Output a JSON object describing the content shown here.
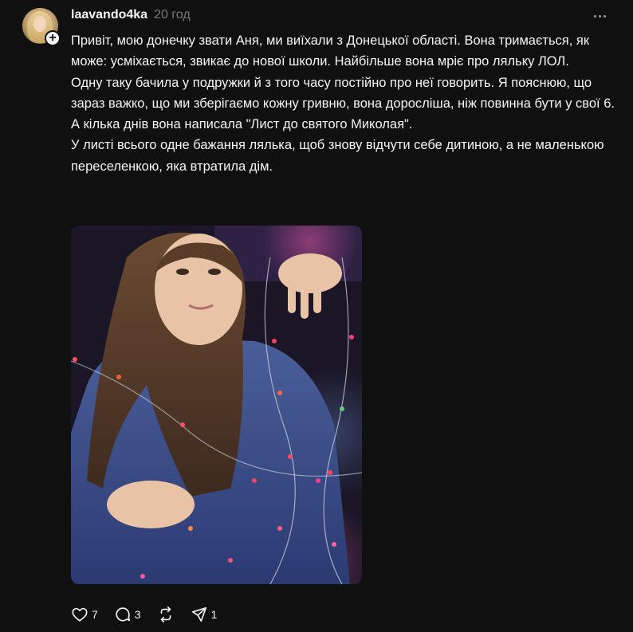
{
  "post": {
    "username": "laavando4ka",
    "timestamp": "20 год",
    "follow_symbol": "+",
    "paragraphs": [
      "Привіт, мою донечку звати Аня, ми виїхали з Донецької області. Вона тримається, як може: усміхається, звикає до нової школи. Найбільше вона мріє про ляльку ЛОЛ.",
      "Одну таку бачила у подружки й з того часу постійно про неї говорить. Я пояснюю, що зараз важко, що ми зберігаємо кожну гривню, вона доросліша, ніж повинна бути у свої 6.",
      "А кілька днів вона написала \"Лист до святого Миколая\".",
      "У листі всього одне бажання лялька, щоб знову відчути себе дитиною, а не маленькою переселенкою, яка втратила дім."
    ],
    "image": {
      "description_icon": "photo-girl-with-fairy-lights"
    }
  },
  "actions": {
    "like": {
      "icon": "heart-icon",
      "count": "7"
    },
    "comment": {
      "icon": "comment-icon",
      "count": "3"
    },
    "repost": {
      "icon": "repost-icon",
      "count": ""
    },
    "share": {
      "icon": "send-icon",
      "count": "1"
    }
  },
  "colors": {
    "background": "#101010",
    "text": "#f3f5f7",
    "muted": "#777777"
  }
}
